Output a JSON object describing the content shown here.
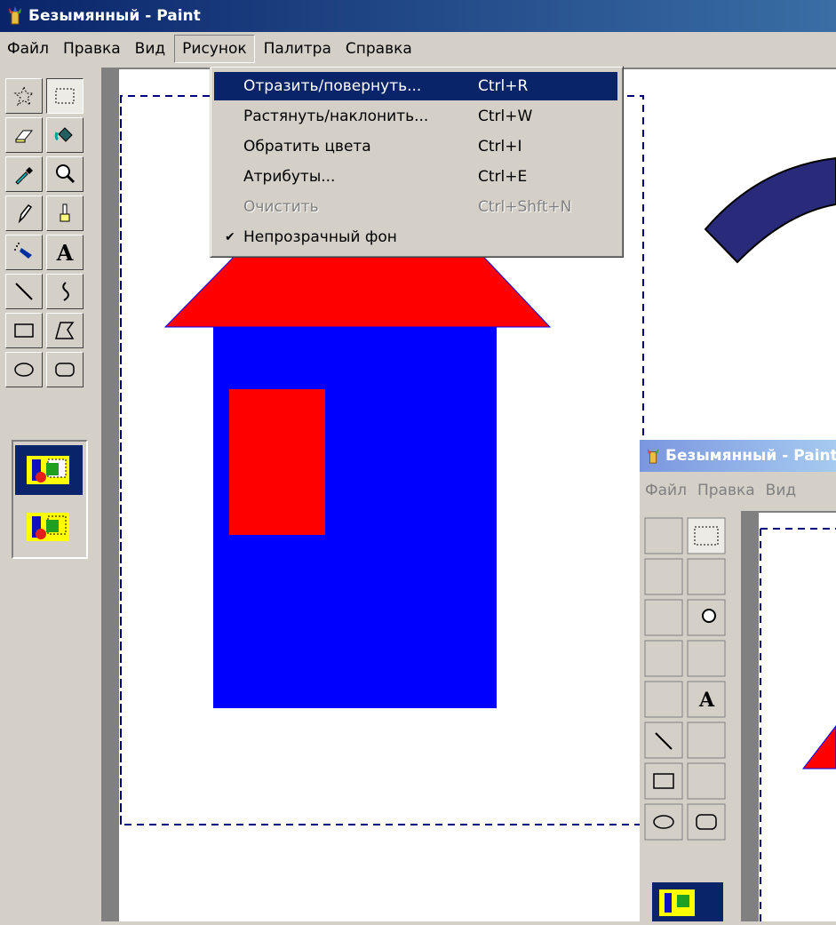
{
  "window": {
    "title": "Безымянный - Paint",
    "menu": [
      "Файл",
      "Правка",
      "Вид",
      "Рисунок",
      "Палитра",
      "Справка"
    ],
    "active_menu_index": 3
  },
  "dropdown": {
    "items": [
      {
        "label": "Отразить/повернуть...",
        "shortcut": "Ctrl+R",
        "highlighted": true
      },
      {
        "label": "Растянуть/наклонить...",
        "shortcut": "Ctrl+W"
      },
      {
        "label": "Обратить цвета",
        "shortcut": "Ctrl+I"
      },
      {
        "label": "Атрибуты...",
        "shortcut": "Ctrl+E"
      },
      {
        "label": "Очистить",
        "shortcut": "Ctrl+Shft+N",
        "disabled": true
      },
      {
        "label": "Непрозрачный фон",
        "shortcut": "",
        "checked": true
      }
    ],
    "check_mark": "✔"
  },
  "tools": [
    "free-select",
    "rect-select",
    "eraser",
    "fill",
    "color-picker",
    "magnifier",
    "pencil",
    "brush",
    "airbrush",
    "text",
    "line",
    "curve",
    "rectangle",
    "polygon",
    "ellipse",
    "rounded-rectangle"
  ],
  "text_tool_glyph": "A",
  "second_window": {
    "title": "Безымянный - Paint",
    "menu": [
      "Файл",
      "Правка",
      "Вид"
    ]
  },
  "colors": {
    "title_active": "#0a246a",
    "title_inactive": "#7a96df",
    "house_roof": "#ff0000",
    "house_body": "#0000ff",
    "arrow": "#2a2a7a"
  }
}
